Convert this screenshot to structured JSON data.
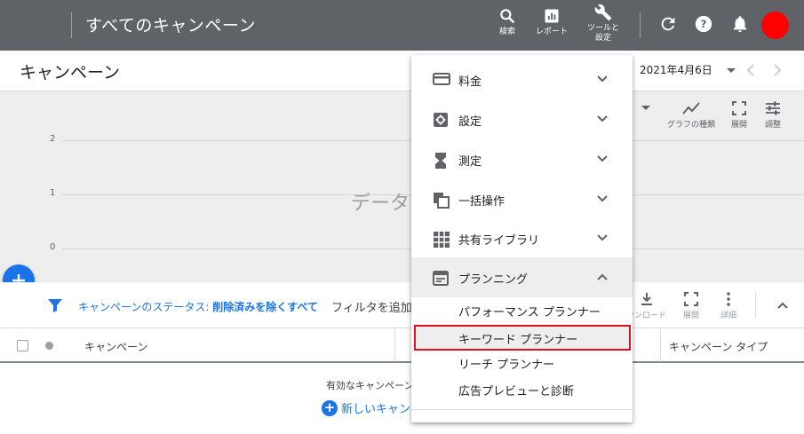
{
  "topbar": {
    "title": "すべてのキャンペーン",
    "search_label": "検索",
    "report_label": "レポート",
    "tools_label_1": "ツールと",
    "tools_label_2": "設定",
    "icons": [
      "search-icon",
      "report-icon",
      "wrench-icon",
      "refresh-icon",
      "help-icon",
      "bell-icon"
    ]
  },
  "subheader": {
    "page_title": "キャンペーン",
    "date": "2021年4月6日"
  },
  "chart": {
    "y_ticks": [
      "2",
      "1",
      "0"
    ],
    "empty_text": "データ",
    "tools": [
      {
        "label": "グラフの種類"
      },
      {
        "label": "展開"
      },
      {
        "label": "調整"
      }
    ]
  },
  "filter": {
    "status_prefix": "キャンペーンのステータス: ",
    "status_value": "削除済みを除くすべて",
    "add_filter": "フィルタを追加",
    "tools": [
      {
        "label": "ウンロード"
      },
      {
        "label": "展開"
      },
      {
        "label": "詳細"
      }
    ]
  },
  "table": {
    "columns": [
      "キャンペーン",
      "キャンペーン タイプ"
    ],
    "empty_text": "有効なキャンペーン",
    "new_campaign": "新しいキャン"
  },
  "menu": {
    "items": [
      {
        "label": "料金",
        "icon": "card-icon"
      },
      {
        "label": "設定",
        "icon": "gear-icon"
      },
      {
        "label": "測定",
        "icon": "hourglass-icon"
      },
      {
        "label": "一括操作",
        "icon": "copy-icon"
      },
      {
        "label": "共有ライブラリ",
        "icon": "grid-icon"
      },
      {
        "label": "プランニング",
        "icon": "calendar-icon"
      }
    ],
    "sub_items": [
      "パフォーマンス プランナー",
      "キーワード プランナー",
      "リーチ プランナー",
      "広告プレビューと診断"
    ]
  },
  "colors": {
    "topbar": "#5f6368",
    "accent": "#1a73e8",
    "highlight_border": "#e4111d",
    "avatar": "#ff0000"
  }
}
